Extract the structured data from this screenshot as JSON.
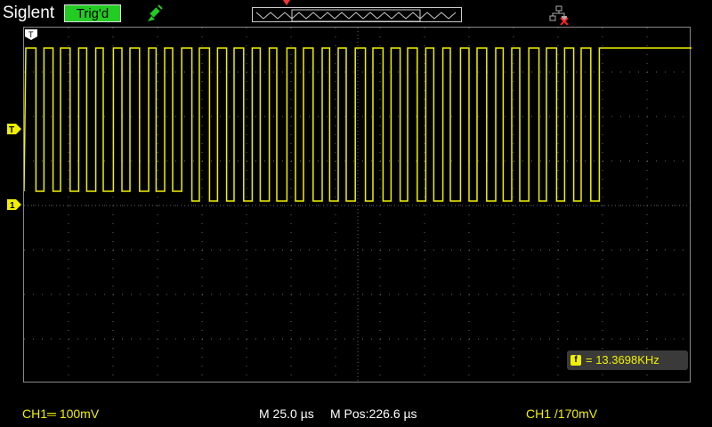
{
  "header": {
    "brand": "Siglent",
    "trigger_status": "Trig'd",
    "icons": {
      "probe": "probe-icon",
      "network": "network-disconnected-icon"
    }
  },
  "markers": {
    "top_trigger_label": "T",
    "trigger_level_label": "T",
    "channel_label": "1"
  },
  "measurement": {
    "frequency_icon_label": "f",
    "frequency_text": "= 13.3698KHz"
  },
  "status": {
    "ch1_scale": "CH1═ 100mV",
    "time_scale": "M 25.0 µs",
    "main_position": "M Pos:226.6 µs",
    "trigger_setting": "CH1 /170mV"
  },
  "colors": {
    "trace": "#f0f000",
    "trig_badge": "#22cc22",
    "grid": "#666666"
  }
}
